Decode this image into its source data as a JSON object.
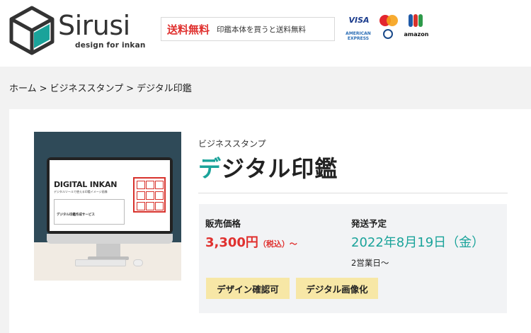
{
  "header": {
    "logo_name": "Sirusi",
    "logo_tagline": "design for inkan",
    "promo_strong": "送料無料",
    "promo_text": "印鑑本体を買うと送料無料",
    "payment_methods": [
      "VISA",
      "MasterCard",
      "JCB",
      "AMERICAN EXPRESS",
      "Diners Club",
      "amazon"
    ]
  },
  "breadcrumb": {
    "items": [
      "ホーム",
      "ビジネススタンプ",
      "デジタル印鑑"
    ],
    "separator": ">"
  },
  "product": {
    "category": "ビジネススタンプ",
    "title_accent": "デ",
    "title_rest": "ジタル印鑑",
    "image": {
      "screen_title": "DIGITAL INKAN",
      "screen_subtitle": "デジタルツールで使える印鑑イメージ画像",
      "form_label": "デジタル印鑑作成サービス"
    },
    "price_label": "販売価格",
    "price_value": "3,300円",
    "price_tax": "（税込）～",
    "shipping_label": "発送予定",
    "shipping_date": "2022年8月19日（金）",
    "shipping_days": "2営業日～",
    "tags": [
      "デザイン確認可",
      "デジタル画像化"
    ]
  },
  "colors": {
    "accent_teal": "#1aa39a",
    "price_red": "#e0312f",
    "tag_yellow": "#f7e7a6",
    "page_gray": "#f2f2f2"
  }
}
